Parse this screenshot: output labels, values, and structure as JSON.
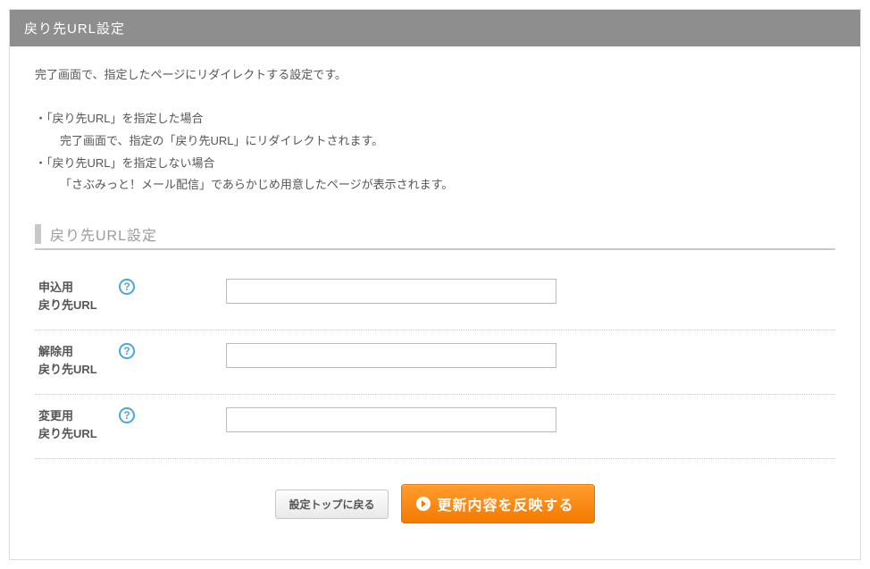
{
  "header": {
    "title": "戻り先URL設定"
  },
  "description": {
    "line1": "完了画面で、指定したページにリダイレクトする設定です。",
    "case1_title": "・「戻り先URL」を指定した場合",
    "case1_body": "完了画面で、指定の「戻り先URL」にリダイレクトされます。",
    "case2_title": "・「戻り先URL」を指定しない場合",
    "case2_body": "「さぶみっと！メール配信」であらかじめ用意したページが表示されます。"
  },
  "section": {
    "title": "戻り先URL設定"
  },
  "fields": {
    "apply": {
      "label1": "申込用",
      "label2": "戻り先URL",
      "value": ""
    },
    "cancel": {
      "label1": "解除用",
      "label2": "戻り先URL",
      "value": ""
    },
    "change": {
      "label1": "変更用",
      "label2": "戻り先URL",
      "value": ""
    }
  },
  "help_symbol": "?",
  "buttons": {
    "back": "設定トップに戻る",
    "submit": "更新内容を反映する"
  },
  "colors": {
    "header_bg": "#8e8e8e",
    "primary": "#f47a00",
    "help": "#4aa6e0"
  }
}
